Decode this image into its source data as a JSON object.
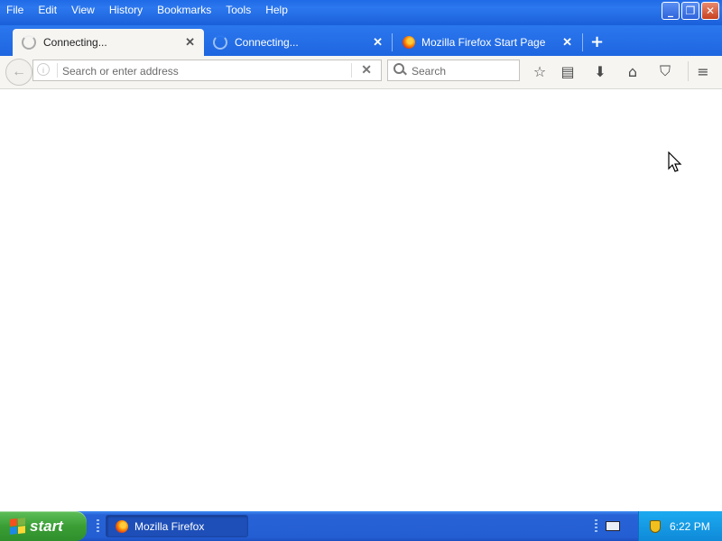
{
  "menu": [
    "File",
    "Edit",
    "View",
    "History",
    "Bookmarks",
    "Tools",
    "Help"
  ],
  "window_buttons": {
    "minimize": "_",
    "restore": "❐",
    "close": "✕"
  },
  "tabs": [
    {
      "label": "Connecting...",
      "close": "✕",
      "state": "active",
      "icon": "loading-spinner-icon"
    },
    {
      "label": "Connecting...",
      "close": "✕",
      "state": "inactive",
      "icon": "loading-spinner-icon"
    },
    {
      "label": "Mozilla Firefox Start Page",
      "close": "✕",
      "state": "inactive",
      "icon": "firefox-icon"
    }
  ],
  "new_tab": "+",
  "navbar": {
    "back": "←",
    "info": "i",
    "address_placeholder": "Search or enter address",
    "clear": "✕",
    "search_placeholder": "Search",
    "bookmark_star": "☆",
    "reading_list": "▤",
    "downloads": "⬇",
    "home": "⌂",
    "pocket": "⛉",
    "menu": "≡"
  },
  "taskbar": {
    "start_label": "start",
    "task_label": "Mozilla Firefox",
    "clock": "6:22 PM"
  },
  "colors": {
    "xp_blue": "#2c78ef",
    "start_green": "#3a9e35",
    "tray_blue": "#0f8ad8",
    "toolbar_bg": "#f6f5f2"
  }
}
